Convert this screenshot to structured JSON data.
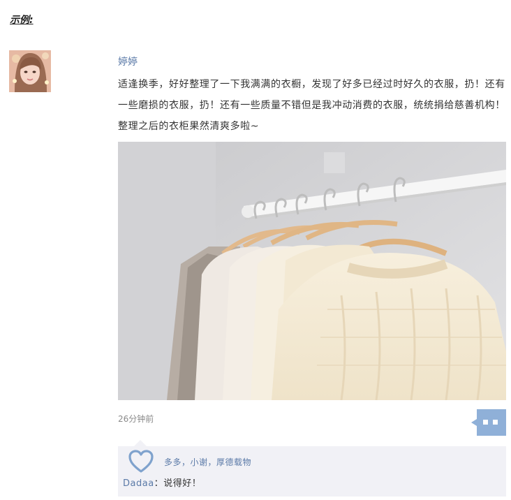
{
  "example_label": "示例:",
  "post": {
    "username": "婷婷",
    "text": "适逢换季，好好整理了一下我满满的衣橱，发现了好多已经过时好久的衣服，扔！还有一些磨损的衣服，扔！还有一些质量不错但是我冲动消费的衣服，统统捐给慈善机构！整理之后的衣柜果然清爽多啦~",
    "timestamp": "26分钟前"
  },
  "likes": {
    "names": "多多，小谢，厚德载物"
  },
  "comment": {
    "user": "Dadaa",
    "separator": "：",
    "text": "说得好！"
  },
  "colors": {
    "link": "#5b7aa8",
    "comment_bg": "#f1f1f6",
    "comment_button": "#8fb0d8"
  },
  "icons": [
    "avatar-photo",
    "heart-icon",
    "comment-icon"
  ]
}
